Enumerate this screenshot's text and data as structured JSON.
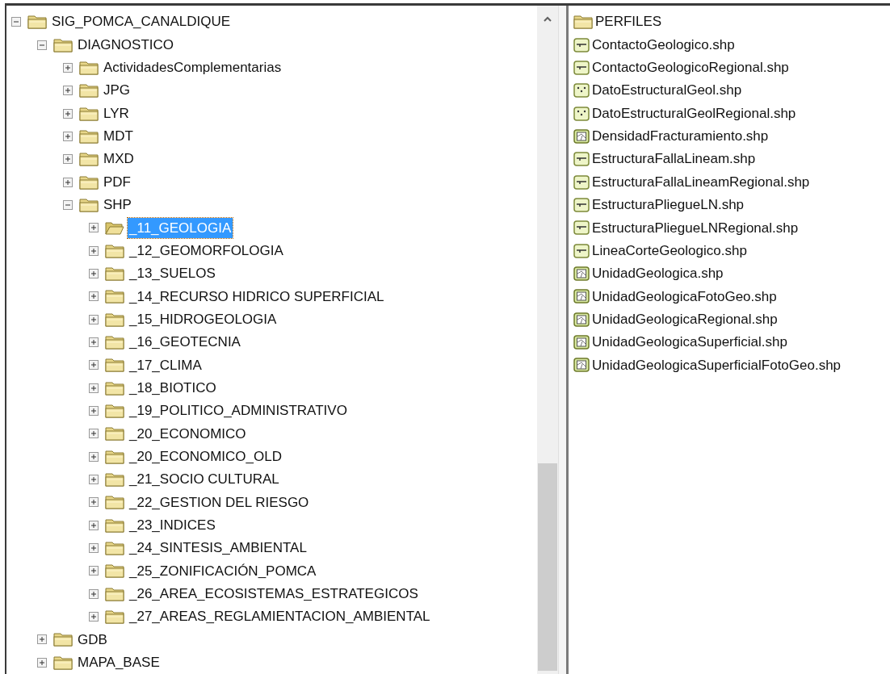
{
  "tree": [
    {
      "label": "SIG_POMCA_CANALDIQUE",
      "expanded": true,
      "selected": false,
      "children": [
        {
          "label": "DIAGNOSTICO",
          "expanded": true,
          "selected": false,
          "children": [
            {
              "label": "ActividadesComplementarias",
              "expanded": false,
              "selected": false
            },
            {
              "label": "JPG",
              "expanded": false,
              "selected": false
            },
            {
              "label": "LYR",
              "expanded": false,
              "selected": false
            },
            {
              "label": "MDT",
              "expanded": false,
              "selected": false
            },
            {
              "label": "MXD",
              "expanded": false,
              "selected": false
            },
            {
              "label": "PDF",
              "expanded": false,
              "selected": false
            },
            {
              "label": "SHP",
              "expanded": true,
              "selected": false,
              "children": [
                {
                  "label": "_11_GEOLOGIA",
                  "expanded": false,
                  "selected": true
                },
                {
                  "label": "_12_GEOMORFOLOGIA",
                  "expanded": false,
                  "selected": false
                },
                {
                  "label": "_13_SUELOS",
                  "expanded": false,
                  "selected": false
                },
                {
                  "label": "_14_RECURSO HIDRICO SUPERFICIAL",
                  "expanded": false,
                  "selected": false
                },
                {
                  "label": "_15_HIDROGEOLOGIA",
                  "expanded": false,
                  "selected": false
                },
                {
                  "label": "_16_GEOTECNIA",
                  "expanded": false,
                  "selected": false
                },
                {
                  "label": "_17_CLIMA",
                  "expanded": false,
                  "selected": false
                },
                {
                  "label": "_18_BIOTICO",
                  "expanded": false,
                  "selected": false
                },
                {
                  "label": "_19_POLITICO_ADMINISTRATIVO",
                  "expanded": false,
                  "selected": false
                },
                {
                  "label": "_20_ECONOMICO",
                  "expanded": false,
                  "selected": false
                },
                {
                  "label": "_20_ECONOMICO_OLD",
                  "expanded": false,
                  "selected": false
                },
                {
                  "label": "_21_SOCIO CULTURAL",
                  "expanded": false,
                  "selected": false
                },
                {
                  "label": "_22_GESTION DEL RIESGO",
                  "expanded": false,
                  "selected": false
                },
                {
                  "label": "_23_INDICES",
                  "expanded": false,
                  "selected": false
                },
                {
                  "label": "_24_SINTESIS_AMBIENTAL",
                  "expanded": false,
                  "selected": false
                },
                {
                  "label": "_25_ZONIFICACIÓN_POMCA",
                  "expanded": false,
                  "selected": false
                },
                {
                  "label": "_26_AREA_ECOSISTEMAS_ESTRATEGICOS",
                  "expanded": false,
                  "selected": false
                },
                {
                  "label": "_27_AREAS_REGLAMIENTACION_AMBIENTAL",
                  "expanded": false,
                  "selected": false
                }
              ]
            }
          ]
        },
        {
          "label": "GDB",
          "expanded": false,
          "selected": false
        },
        {
          "label": "MAPA_BASE",
          "expanded": false,
          "selected": false
        }
      ]
    }
  ],
  "contents": [
    {
      "name": "PERFILES",
      "kind": "folder"
    },
    {
      "name": "ContactoGeologico.shp",
      "kind": "line"
    },
    {
      "name": "ContactoGeologicoRegional.shp",
      "kind": "line"
    },
    {
      "name": "DatoEstructuralGeol.shp",
      "kind": "point"
    },
    {
      "name": "DatoEstructuralGeolRegional.shp",
      "kind": "point"
    },
    {
      "name": "DensidadFracturamiento.shp",
      "kind": "polygon"
    },
    {
      "name": "EstructuraFallaLineam.shp",
      "kind": "line"
    },
    {
      "name": "EstructuraFallaLineamRegional.shp",
      "kind": "line"
    },
    {
      "name": "EstructuraPliegueLN.shp",
      "kind": "line"
    },
    {
      "name": "EstructuraPliegueLNRegional.shp",
      "kind": "line"
    },
    {
      "name": "LineaCorteGeologico.shp",
      "kind": "line"
    },
    {
      "name": "UnidadGeologica.shp",
      "kind": "polygon"
    },
    {
      "name": "UnidadGeologicaFotoGeo.shp",
      "kind": "polygon"
    },
    {
      "name": "UnidadGeologicaRegional.shp",
      "kind": "polygon"
    },
    {
      "name": "UnidadGeologicaSuperficial.shp",
      "kind": "polygon"
    },
    {
      "name": "UnidadGeologicaSuperficialFotoGeo.shp",
      "kind": "polygon"
    }
  ]
}
